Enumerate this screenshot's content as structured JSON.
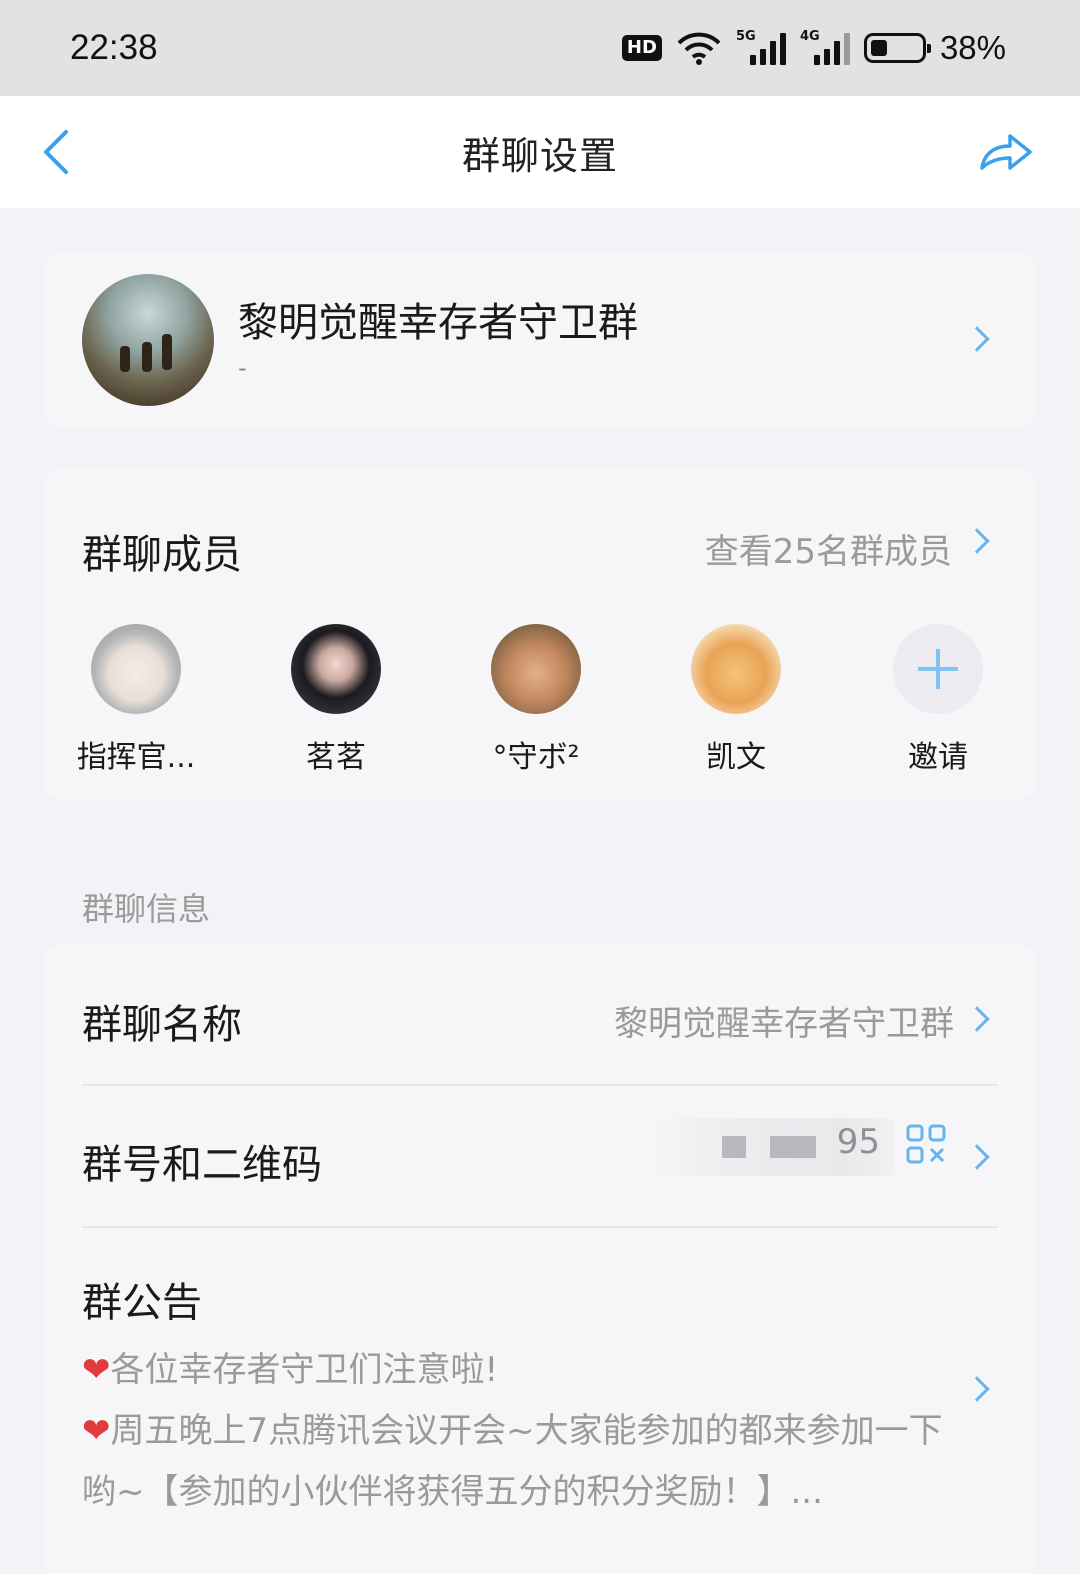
{
  "status_bar": {
    "time": "22:38",
    "hd_badge": "HD",
    "signal_5g": "5G",
    "signal_4g": "4G",
    "battery_percent": "38%",
    "battery_level": 0.38
  },
  "nav": {
    "title": "群聊设置",
    "back_icon": "chevron-left-icon",
    "share_icon": "share-arrow-icon"
  },
  "group": {
    "name": "黎明觉醒幸存者守卫群",
    "subtitle": "-"
  },
  "members": {
    "title": "群聊成员",
    "view_all": "查看25名群成员",
    "list": [
      {
        "name": "指挥官..."
      },
      {
        "name": "茗茗"
      },
      {
        "name": "°守ボ²"
      },
      {
        "name": "凯文"
      }
    ],
    "invite_label": "邀请"
  },
  "info": {
    "section_label": "群聊信息",
    "name_row": {
      "title": "群聊名称",
      "value": "黎明觉醒幸存者守卫群"
    },
    "qr_row": {
      "title": "群号和二维码",
      "value_tail": "95"
    },
    "notice": {
      "title": "群公告",
      "line1": "各位幸存者守卫们注意啦!",
      "line2": "周五晚上7点腾讯会议开会~大家能参加的都来参加一下哟~【参加的小伙伴将获得五分的积分奖励！】...",
      "heart": "❤"
    }
  },
  "colors": {
    "accent": "#66b4ee",
    "background": "#f3f3f7",
    "muted_text": "#9a9a9a"
  }
}
